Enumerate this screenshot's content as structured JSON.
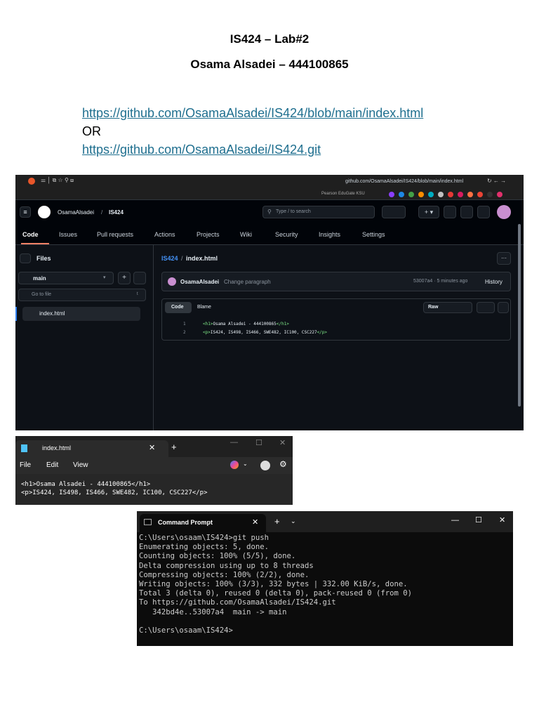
{
  "document": {
    "title": "IS424 – Lab#2",
    "author_line": "Osama Alsadei – 444100865",
    "link1": "https://github.com/OsamaAlsadei/IS424/blob/main/index.html",
    "or": "OR",
    "link2": "https://github.com/OsamaAlsadei/IS424.git"
  },
  "github": {
    "address": "github.com/OsamaAlsadei/IS424/blob/main/index.html",
    "bookmarks": "Pearson  EduGate KSU",
    "owner": "OsamaAlsadei",
    "separator": "/",
    "repo": "IS424",
    "search_placeholder": "Type / to search",
    "tabs": [
      "Code",
      "Issues",
      "Pull requests",
      "Actions",
      "Projects",
      "Wiki",
      "Security",
      "Insights",
      "Settings"
    ],
    "sidebar": {
      "title": "Files",
      "branch": "main",
      "goto_placeholder": "Go to file",
      "goto_shortcut": "t",
      "file": "index.html"
    },
    "breadcrumb_repo": "IS424",
    "breadcrumb_file": "index.html",
    "commit": {
      "author": "OsamaAlsadei",
      "message": "Change paragraph",
      "meta": "53007a4 · 5 minutes ago",
      "history": "History"
    },
    "view_tabs": [
      "Code",
      "Blame"
    ],
    "raw": "Raw",
    "code": [
      {
        "n": "1",
        "open": "<h1>",
        "text": "Osama Alsadei - 444100865",
        "close": "</h1>"
      },
      {
        "n": "2",
        "open": "<p>",
        "text": "IS424, IS498, IS466, SWE482, IC100, CSC227",
        "close": "</p>"
      }
    ],
    "more": "···"
  },
  "notepad": {
    "tab_title": "index.html",
    "menu": [
      "File",
      "Edit",
      "View"
    ],
    "lines": [
      "<h1>Osama Alsadei - 444100865</h1>",
      "<p>IS424, IS498, IS466, SWE482, IC100, CSC227</p>"
    ]
  },
  "cmd": {
    "tab_title": "Command Prompt",
    "lines": [
      "C:\\Users\\osaam\\IS424>git push",
      "Enumerating objects: 5, done.",
      "Counting objects: 100% (5/5), done.",
      "Delta compression using up to 8 threads",
      "Compressing objects: 100% (2/2), done.",
      "Writing objects: 100% (3/3), 332 bytes | 332.00 KiB/s, done.",
      "Total 3 (delta 0), reused 0 (delta 0), pack-reused 0 (from 0)",
      "To https://github.com/OsamaAlsadei/IS424.git",
      "   342bd4e..53007a4  main -> main",
      "",
      "C:\\Users\\osaam\\IS424>"
    ]
  }
}
